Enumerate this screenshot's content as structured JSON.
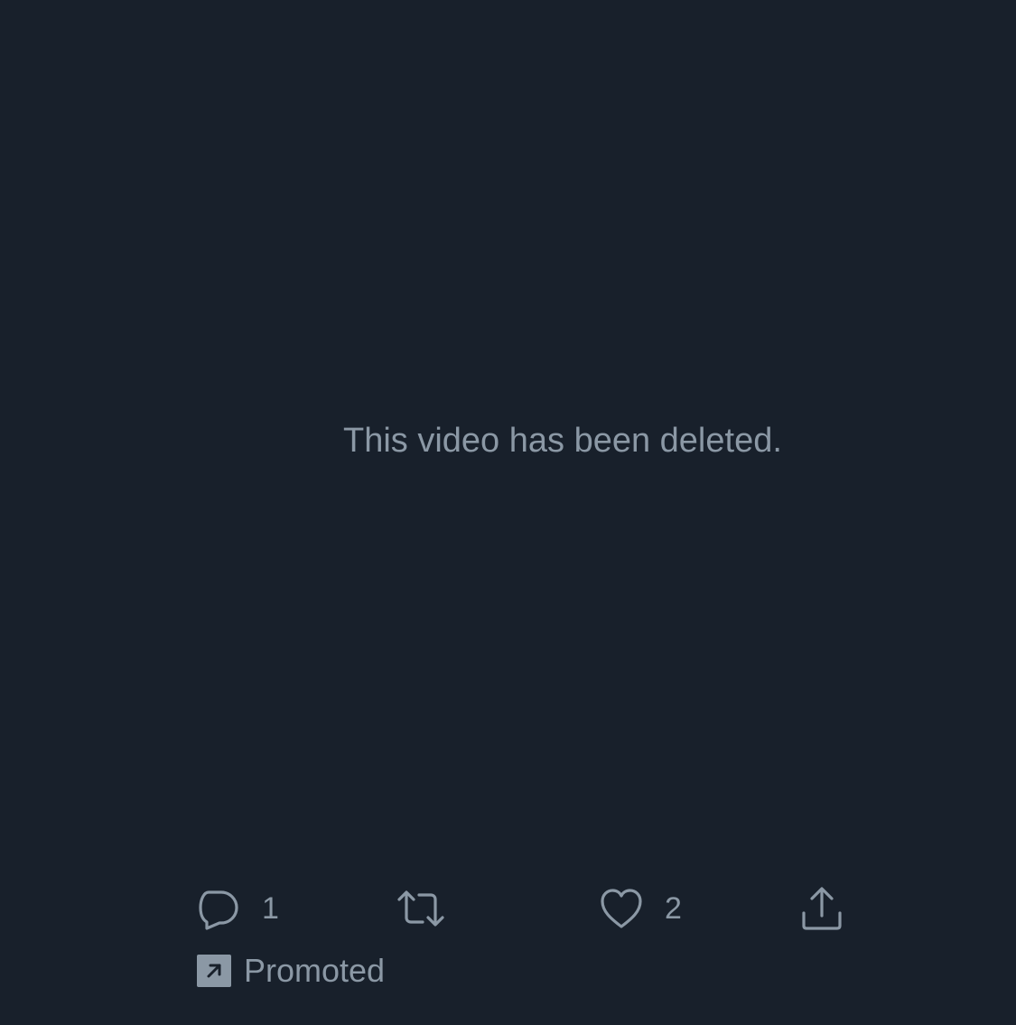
{
  "media": {
    "message": "This video has been deleted."
  },
  "actions": {
    "reply": {
      "icon": "reply-icon",
      "count": "1"
    },
    "retweet": {
      "icon": "retweet-icon",
      "count": ""
    },
    "like": {
      "icon": "heart-icon",
      "count": "2"
    },
    "share": {
      "icon": "share-icon"
    }
  },
  "promoted": {
    "icon": "promoted-arrow-icon",
    "label": "Promoted"
  },
  "colors": {
    "background": "#18202b",
    "secondary_text": "#8b98a5"
  }
}
